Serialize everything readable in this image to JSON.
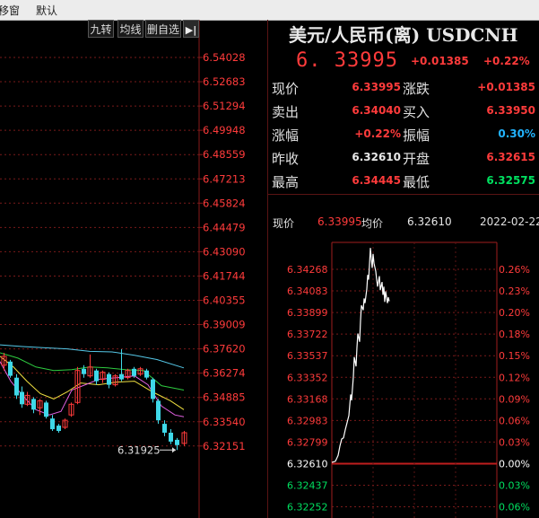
{
  "menubar": {
    "items": [
      "移窗",
      "默认"
    ]
  },
  "toolbar": {
    "buttons": [
      "九转",
      "均线",
      "删自选"
    ],
    "expand_icon": "arrow-right-bar-icon"
  },
  "kline": {
    "price_ticks": [
      "6.54028",
      "6.52683",
      "6.51294",
      "6.49948",
      "6.48559",
      "6.47213",
      "6.45824",
      "6.44479",
      "6.43090",
      "6.41744",
      "6.40355",
      "6.39009",
      "6.37620",
      "6.36274",
      "6.34885",
      "6.33540",
      "6.32151"
    ],
    "low_marker": "6.31925"
  },
  "quote": {
    "title": "美元/人民币(离) USDCNH",
    "price": "6. 33995",
    "change": "+0.01385",
    "change_pct": "+0.22%",
    "rows": [
      {
        "l1": "现价",
        "v1": "6.33995",
        "l2": "涨跌",
        "v2": "+0.01385"
      },
      {
        "l1": "卖出",
        "v1": "6.34040",
        "l2": "买入",
        "v2": "6.33950"
      },
      {
        "l1": "涨幅",
        "v1": "+0.22%",
        "l2": "振幅",
        "v2": "0.30%"
      },
      {
        "l1": "昨收",
        "v1": "6.32610",
        "l2": "开盘",
        "v2": "6.32615"
      },
      {
        "l1": "最高",
        "v1": "6.34445",
        "l2": "最低",
        "v2": "6.32575"
      }
    ],
    "colors": {
      "up": "#ff3b3b",
      "down": "#00e060",
      "neutral": "#e8e8e8",
      "amplitude": "#22b4ff"
    }
  },
  "minute": {
    "price_label": "现价",
    "price_value": "6.33995",
    "avg_label": "均价",
    "avg_value": "6.32610",
    "date": "2022-02-22",
    "price_ticks": [
      "6.34268",
      "6.34083",
      "6.33899",
      "6.33722",
      "6.33537",
      "6.33352",
      "6.33168",
      "6.32983",
      "6.32799",
      "6.32610",
      "6.32437",
      "6.32252"
    ],
    "pct_ticks": [
      "0.26%",
      "0.23%",
      "0.20%",
      "0.18%",
      "0.15%",
      "0.12%",
      "0.09%",
      "0.06%",
      "0.03%",
      "0.00%",
      "0.03%",
      "0.06%"
    ]
  }
}
